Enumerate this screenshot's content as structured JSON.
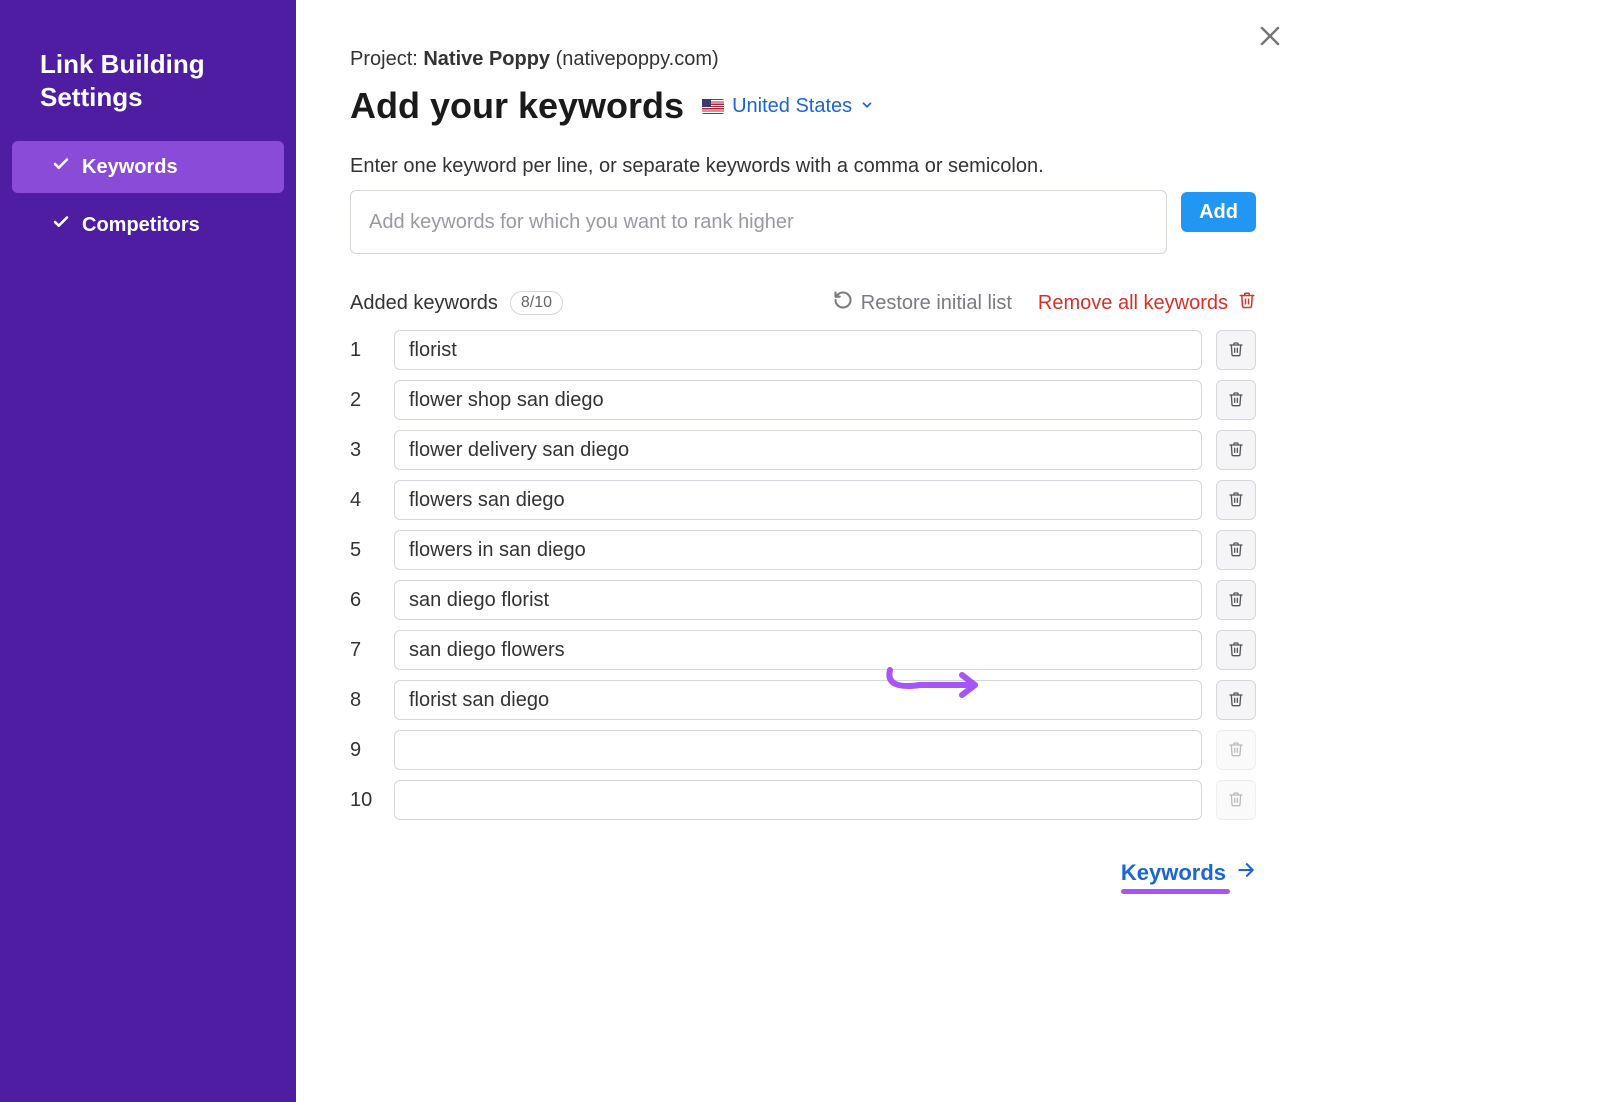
{
  "sidebar": {
    "title": "Link Building Settings",
    "items": [
      {
        "label": "Keywords",
        "active": true
      },
      {
        "label": "Competitors",
        "active": false
      }
    ]
  },
  "project": {
    "prefix": "Project: ",
    "name": "Native Poppy",
    "domain": " (nativepoppy.com)"
  },
  "title": "Add your keywords",
  "country": {
    "label": "United States"
  },
  "help_text": "Enter one keyword per line, or separate keywords with a comma or semicolon.",
  "input": {
    "placeholder": "Add keywords for which you want to rank higher"
  },
  "add_button": "Add",
  "added_label": "Added keywords",
  "count": "8/10",
  "restore_label": "Restore initial list",
  "remove_all_label": "Remove all keywords",
  "keywords": [
    "florist",
    "flower shop san diego",
    "flower delivery san diego",
    "flowers san diego",
    "flowers in san diego",
    "san diego florist",
    "san diego flowers",
    "florist san diego",
    "",
    ""
  ],
  "next_label": "Keywords"
}
